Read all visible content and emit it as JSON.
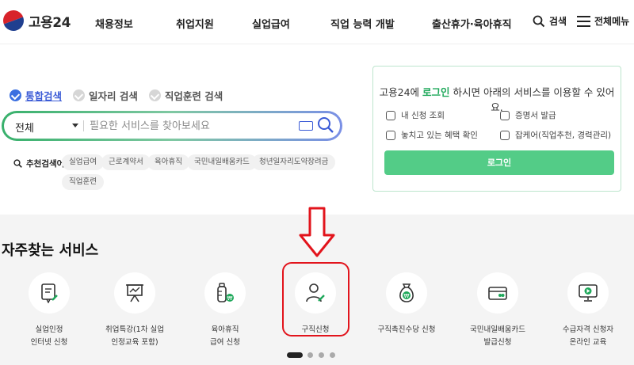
{
  "header": {
    "logo_text": "고용24",
    "nav": [
      "채용정보",
      "취업지원",
      "실업급여",
      "직업 능력 개발",
      "출산휴가·육아휴직"
    ],
    "search_label": "검색",
    "menu_label": "전체메뉴"
  },
  "search": {
    "tabs": [
      {
        "label": "통합검색",
        "active": true
      },
      {
        "label": "일자리 검색",
        "active": false
      },
      {
        "label": "직업훈련 검색",
        "active": false
      }
    ],
    "category": "전체",
    "placeholder": "필요한 서비스를 찾아보세요",
    "recommend_label": "추천검색어",
    "recommend_tags": [
      "실업급여",
      "근로계약서",
      "육아휴직",
      "국민내일배움카드",
      "청년일자리도약장려금",
      "직업훈련"
    ]
  },
  "login_panel": {
    "msg_prefix": "고용24에 ",
    "msg_highlight": "로그인",
    "msg_suffix": " 하시면 아래의 서비스를 이용할 수 있어요.",
    "items": [
      "내 신청 조회",
      "증명서 발급",
      "놓치고 있는 혜택 확인",
      "잡케어(직업추천, 경력관리)"
    ],
    "button": "로그인"
  },
  "frequent": {
    "title": "자주찾는 서비스",
    "services": [
      {
        "line1": "실업인정",
        "line2": "인터넷 신청",
        "icon": "certificate-edit-icon"
      },
      {
        "line1": "취업특강(1차 실업",
        "line2": "인정교육 포함)",
        "icon": "presentation-board-icon"
      },
      {
        "line1": "육아휴직",
        "line2": "급여 신청",
        "icon": "baby-bottle-icon"
      },
      {
        "line1": "구직신청",
        "line2": "",
        "icon": "person-edit-icon"
      },
      {
        "line1": "구직촉진수당 신청",
        "line2": "",
        "icon": "money-bag-icon"
      },
      {
        "line1": "국민내일배움카드",
        "line2": "발급신청",
        "icon": "card-icon"
      },
      {
        "line1": "수급자격 신청자",
        "line2": "온라인 교육",
        "icon": "monitor-play-icon"
      }
    ]
  },
  "colors": {
    "brand_green": "#53cc87",
    "highlight_red": "#e2141c",
    "tab_blue": "#3b5bd6"
  }
}
